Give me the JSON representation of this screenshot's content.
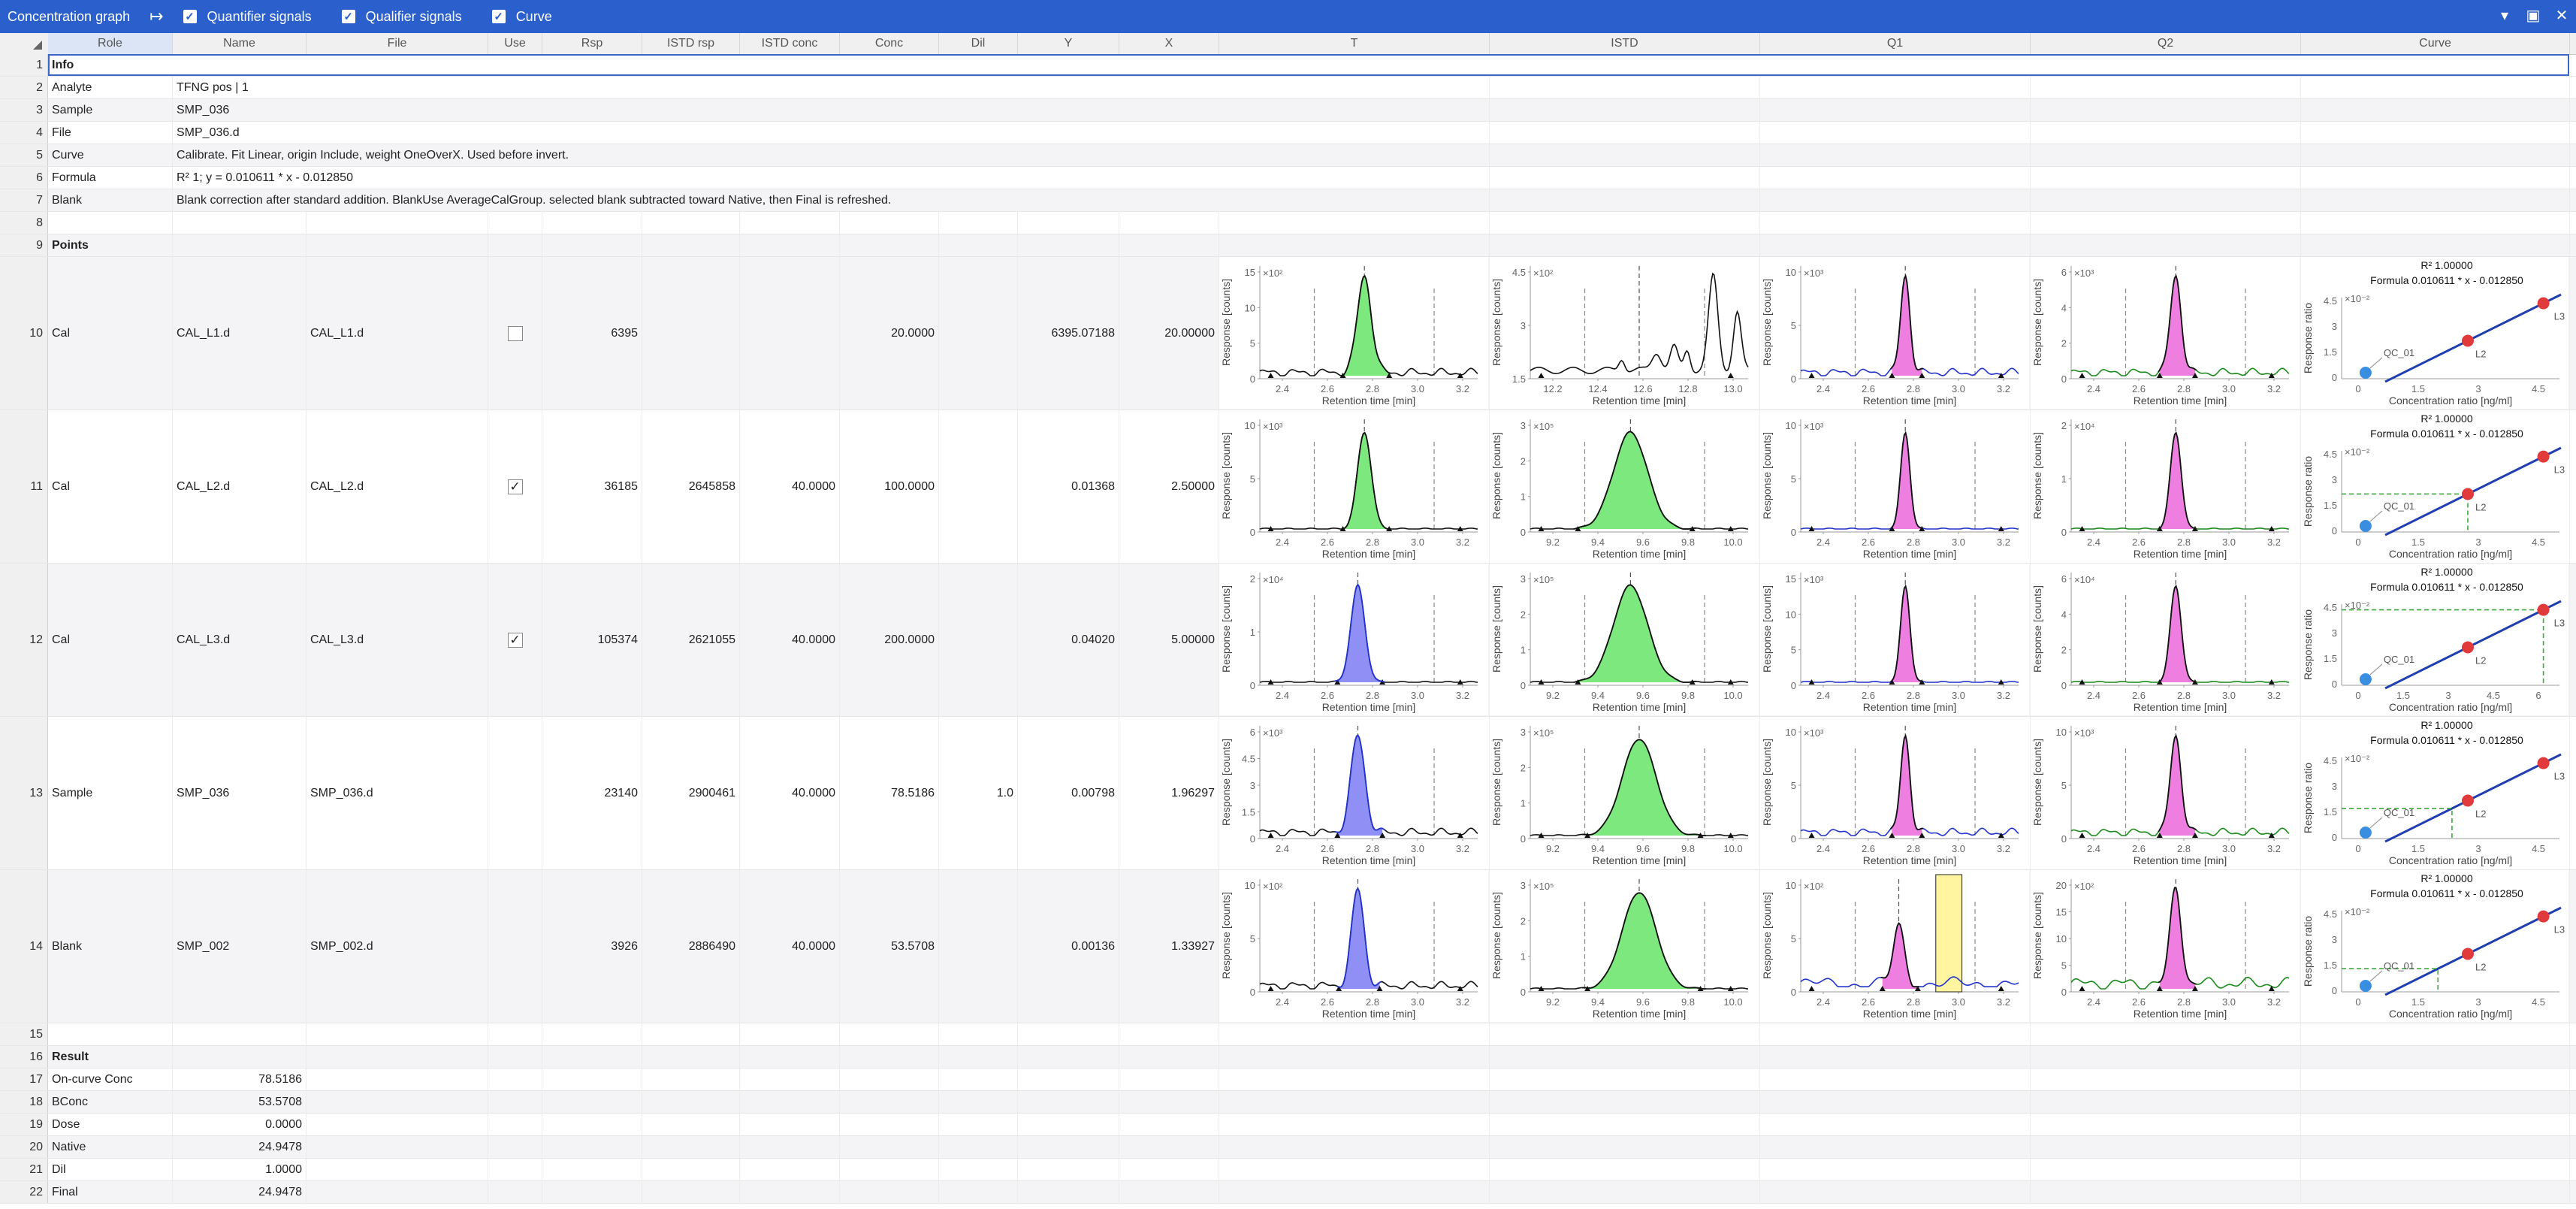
{
  "window": {
    "title": "Concentration graph",
    "expand_glyph": "↦",
    "toggles": [
      {
        "label": "Quantifier signals",
        "checked": true
      },
      {
        "label": "Qualifier signals",
        "checked": true
      },
      {
        "label": "Curve",
        "checked": true
      }
    ],
    "controls": [
      "▾",
      "▣",
      "✕"
    ]
  },
  "columns": [
    "Role",
    "Name",
    "File",
    "Use",
    "Rsp",
    "ISTD rsp",
    "ISTD conc",
    "Conc",
    "Dil",
    "Y",
    "X",
    "T",
    "ISTD",
    "Q1",
    "Q2",
    "Curve"
  ],
  "info": {
    "heading": "Info",
    "rows": [
      {
        "key": "Analyte",
        "value": "TFNG pos | 1"
      },
      {
        "key": "Sample",
        "value": "SMP_036"
      },
      {
        "key": "File",
        "value": "SMP_036.d"
      },
      {
        "key": "Curve",
        "value": "Calibrate. Fit Linear, origin Include, weight OneOverX. Used before invert."
      },
      {
        "key": "Formula",
        "value": "R² 1; y = 0.010611 * x - 0.012850"
      },
      {
        "key": "Blank",
        "value": "Blank correction after standard addition. BlankUse AverageCalGroup. selected blank subtracted toward Native, then Final is refreshed."
      }
    ]
  },
  "points_heading": "Points",
  "points": [
    {
      "n": "10",
      "role": "Cal",
      "name": "CAL_L1.d",
      "file": "CAL_L1.d",
      "use": false,
      "rsp": "6395",
      "istd_rsp": "",
      "istd_conc": "",
      "conc": "20.0000",
      "dil": "",
      "y": "6395.07188",
      "x": "20.00000"
    },
    {
      "n": "11",
      "role": "Cal",
      "name": "CAL_L2.d",
      "file": "CAL_L2.d",
      "use": true,
      "rsp": "36185",
      "istd_rsp": "2645858",
      "istd_conc": "40.0000",
      "conc": "100.0000",
      "dil": "",
      "y": "0.01368",
      "x": "2.50000"
    },
    {
      "n": "12",
      "role": "Cal",
      "name": "CAL_L3.d",
      "file": "CAL_L3.d",
      "use": true,
      "rsp": "105374",
      "istd_rsp": "2621055",
      "istd_conc": "40.0000",
      "conc": "200.0000",
      "dil": "",
      "y": "0.04020",
      "x": "5.00000"
    },
    {
      "n": "13",
      "role": "Sample",
      "name": "SMP_036",
      "file": "SMP_036.d",
      "use": null,
      "rsp": "23140",
      "istd_rsp": "2900461",
      "istd_conc": "40.0000",
      "conc": "78.5186",
      "dil": "1.0",
      "y": "0.00798",
      "x": "1.96297"
    },
    {
      "n": "14",
      "role": "Blank",
      "name": "SMP_002",
      "file": "SMP_002.d",
      "use": null,
      "rsp": "3926",
      "istd_rsp": "2886490",
      "istd_conc": "40.0000",
      "conc": "53.5708",
      "dil": "",
      "y": "0.00136",
      "x": "1.33927"
    }
  ],
  "result_heading": "Result",
  "results": [
    {
      "n": "17",
      "key": "On-curve Conc",
      "value": "78.5186"
    },
    {
      "n": "18",
      "key": "BConc",
      "value": "53.5708"
    },
    {
      "n": "19",
      "key": "Dose",
      "value": "0.0000"
    },
    {
      "n": "20",
      "key": "Native",
      "value": "24.9478"
    },
    {
      "n": "21",
      "key": "Dil",
      "value": "1.0000"
    },
    {
      "n": "22",
      "key": "Final",
      "value": "24.9478"
    }
  ],
  "plot_text": {
    "x_rt": "Retention time [min]",
    "y_rsp": "Response [counts]",
    "x_curve": "Concentration ratio [ng/ml]",
    "y_curve": "Response ratio",
    "r2": "R² 1.00000",
    "formula": "Formula 0.010611 * x - 0.012850",
    "qc_label": "QC_01",
    "l2": "L2",
    "l3": "L3",
    "curve_exp": "×10⁻²"
  },
  "colors": {
    "quant_green": "#7de87d",
    "quant_blue": "#8f8ff5",
    "qual_pink": "#ee7fe0",
    "highlight": "#fff5a0",
    "curve_line": "#1f3fb0",
    "pt_red": "#e03a3a",
    "pt_blue": "#3a8ee0"
  },
  "plots": [
    [
      {
        "kind": "chrom",
        "exp": "×10²",
        "ticks_y": [
          "15",
          "10",
          "5",
          "0"
        ],
        "ticks_x": [
          "2.4",
          "2.6",
          "2.8",
          "3.0",
          "3.2"
        ],
        "fill": "quant_green",
        "line": "#111",
        "base": "#111",
        "peak": 0.48,
        "width": 0.045,
        "noise": "low"
      },
      {
        "kind": "chrom",
        "exp": "×10²",
        "ticks_y": [
          "4.5",
          "3",
          "1.5"
        ],
        "ticks_x": [
          "12.2",
          "12.4",
          "12.6",
          "12.8",
          "13.0"
        ],
        "fill": "none",
        "line": "#111",
        "base": "#111",
        "peak": 0.5,
        "width": 0.0,
        "noise": "istd1"
      },
      {
        "kind": "chrom",
        "exp": "×10³",
        "ticks_y": [
          "10",
          "5",
          "0"
        ],
        "ticks_x": [
          "2.4",
          "2.6",
          "2.8",
          "3.0",
          "3.2"
        ],
        "fill": "qual_pink",
        "line": "#111",
        "base": "#2233cc",
        "peak": 0.48,
        "width": 0.03,
        "noise": "low"
      },
      {
        "kind": "chrom",
        "exp": "×10³",
        "ticks_y": [
          "6",
          "4",
          "2",
          "0"
        ],
        "ticks_x": [
          "2.4",
          "2.6",
          "2.8",
          "3.0",
          "3.2"
        ],
        "fill": "qual_pink",
        "line": "#111",
        "base": "#1a8a1a",
        "peak": 0.48,
        "width": 0.035,
        "noise": "low"
      },
      {
        "kind": "curve",
        "ticks_y": [
          "4.5",
          "3",
          "1.5",
          "0"
        ],
        "ticks_x": [
          "0",
          "1.5",
          "3",
          "4.5"
        ],
        "qc": [
          0.8,
          0.8
        ],
        "guide": false
      }
    ],
    [
      {
        "kind": "chrom",
        "exp": "×10³",
        "ticks_y": [
          "10",
          "5",
          "0"
        ],
        "ticks_x": [
          "2.4",
          "2.6",
          "2.8",
          "3.0",
          "3.2"
        ],
        "fill": "quant_green",
        "line": "#111",
        "base": "#111",
        "peak": 0.48,
        "width": 0.045,
        "noise": "flat"
      },
      {
        "kind": "chrom",
        "exp": "×10⁵",
        "ticks_y": [
          "3",
          "2",
          "1",
          "0"
        ],
        "ticks_x": [
          "9.2",
          "9.4",
          "9.6",
          "9.8",
          "10.0"
        ],
        "fill": "quant_green",
        "line": "#111",
        "base": "#111",
        "peak": 0.46,
        "width": 0.11,
        "noise": "flat"
      },
      {
        "kind": "chrom",
        "exp": "×10³",
        "ticks_y": [
          "10",
          "5",
          "0"
        ],
        "ticks_x": [
          "2.4",
          "2.6",
          "2.8",
          "3.0",
          "3.2"
        ],
        "fill": "qual_pink",
        "line": "#111",
        "base": "#2233cc",
        "peak": 0.48,
        "width": 0.03,
        "noise": "flat"
      },
      {
        "kind": "chrom",
        "exp": "×10⁴",
        "ticks_y": [
          "2",
          "1",
          "0"
        ],
        "ticks_x": [
          "2.4",
          "2.6",
          "2.8",
          "3.0",
          "3.2"
        ],
        "fill": "qual_pink",
        "line": "#111",
        "base": "#1a8a1a",
        "peak": 0.48,
        "width": 0.035,
        "noise": "flat"
      },
      {
        "kind": "curve",
        "ticks_y": [
          "4.5",
          "3",
          "1.5",
          "0"
        ],
        "ticks_x": [
          "0",
          "1.5",
          "3",
          "4.5"
        ],
        "qc": [
          0.8,
          0.8
        ],
        "guide": "L2"
      }
    ],
    [
      {
        "kind": "chrom",
        "exp": "×10⁴",
        "ticks_y": [
          "2",
          "1",
          "0"
        ],
        "ticks_x": [
          "2.4",
          "2.6",
          "2.8",
          "3.0",
          "3.2"
        ],
        "fill": "quant_blue",
        "line": "#2233cc",
        "base": "#111",
        "peak": 0.45,
        "width": 0.045,
        "noise": "flat"
      },
      {
        "kind": "chrom",
        "exp": "×10⁵",
        "ticks_y": [
          "3",
          "2",
          "1",
          "0"
        ],
        "ticks_x": [
          "9.2",
          "9.4",
          "9.6",
          "9.8",
          "10.0"
        ],
        "fill": "quant_green",
        "line": "#111",
        "base": "#111",
        "peak": 0.46,
        "width": 0.11,
        "noise": "flat"
      },
      {
        "kind": "chrom",
        "exp": "×10³",
        "ticks_y": [
          "15",
          "10",
          "5",
          "0"
        ],
        "ticks_x": [
          "2.4",
          "2.6",
          "2.8",
          "3.0",
          "3.2"
        ],
        "fill": "qual_pink",
        "line": "#111",
        "base": "#2233cc",
        "peak": 0.48,
        "width": 0.03,
        "noise": "flat"
      },
      {
        "kind": "chrom",
        "exp": "×10⁴",
        "ticks_y": [
          "6",
          "4",
          "2",
          "0"
        ],
        "ticks_x": [
          "2.4",
          "2.6",
          "2.8",
          "3.0",
          "3.2"
        ],
        "fill": "qual_pink",
        "line": "#111",
        "base": "#1a8a1a",
        "peak": 0.48,
        "width": 0.035,
        "noise": "flat"
      },
      {
        "kind": "curve",
        "ticks_y": [
          "4.5",
          "3",
          "1.5",
          "0"
        ],
        "ticks_x": [
          "0",
          "1.5",
          "3",
          "4.5",
          "6"
        ],
        "qc": [
          0.8,
          0.8
        ],
        "guide": "L3"
      }
    ],
    [
      {
        "kind": "chrom",
        "exp": "×10³",
        "ticks_y": [
          "6",
          "4.5",
          "3",
          "1.5",
          "0"
        ],
        "ticks_x": [
          "2.4",
          "2.6",
          "2.8",
          "3.0",
          "3.2"
        ],
        "fill": "quant_blue",
        "line": "#2233cc",
        "base": "#111",
        "peak": 0.45,
        "width": 0.045,
        "noise": "low"
      },
      {
        "kind": "chrom",
        "exp": "×10⁵",
        "ticks_y": [
          "3",
          "2",
          "1",
          "0"
        ],
        "ticks_x": [
          "9.2",
          "9.4",
          "9.6",
          "9.8",
          "10.0"
        ],
        "fill": "quant_green",
        "line": "#111",
        "base": "#111",
        "peak": 0.5,
        "width": 0.11,
        "noise": "flat"
      },
      {
        "kind": "chrom",
        "exp": "×10³",
        "ticks_y": [
          "10",
          "5",
          "0"
        ],
        "ticks_x": [
          "2.4",
          "2.6",
          "2.8",
          "3.0",
          "3.2"
        ],
        "fill": "qual_pink",
        "line": "#111",
        "base": "#2233cc",
        "peak": 0.48,
        "width": 0.03,
        "noise": "low"
      },
      {
        "kind": "chrom",
        "exp": "×10³",
        "ticks_y": [
          "10",
          "5",
          "0"
        ],
        "ticks_x": [
          "2.4",
          "2.6",
          "2.8",
          "3.0",
          "3.2"
        ],
        "fill": "qual_pink",
        "line": "#111",
        "base": "#1a8a1a",
        "peak": 0.48,
        "width": 0.035,
        "noise": "low"
      },
      {
        "kind": "curve",
        "ticks_y": [
          "4.5",
          "3",
          "1.5",
          "0"
        ],
        "ticks_x": [
          "0",
          "1.5",
          "3",
          "4.5"
        ],
        "qc": [
          0.8,
          0.8
        ],
        "guide": "sample"
      }
    ],
    [
      {
        "kind": "chrom",
        "exp": "×10²",
        "ticks_y": [
          "10",
          "5",
          "0"
        ],
        "ticks_x": [
          "2.4",
          "2.6",
          "2.8",
          "3.0",
          "3.2"
        ],
        "fill": "quant_blue",
        "line": "#2233cc",
        "base": "#111",
        "peak": 0.45,
        "width": 0.04,
        "noise": "low"
      },
      {
        "kind": "chrom",
        "exp": "×10⁵",
        "ticks_y": [
          "3",
          "2",
          "1",
          "0"
        ],
        "ticks_x": [
          "9.2",
          "9.4",
          "9.6",
          "9.8",
          "10.0"
        ],
        "fill": "quant_green",
        "line": "#111",
        "base": "#111",
        "peak": 0.5,
        "width": 0.11,
        "noise": "flat"
      },
      {
        "kind": "chrom",
        "exp": "×10²",
        "ticks_y": [
          "10",
          "5",
          "0"
        ],
        "ticks_x": [
          "2.4",
          "2.6",
          "2.8",
          "3.0",
          "3.2"
        ],
        "fill": "qual_pink",
        "line": "#111",
        "base": "#2233cc",
        "peak": 0.45,
        "width": 0.035,
        "noise": "blank",
        "highlight": true
      },
      {
        "kind": "chrom",
        "exp": "×10²",
        "ticks_y": [
          "20",
          "15",
          "10",
          "5",
          "0"
        ],
        "ticks_x": [
          "2.4",
          "2.6",
          "2.8",
          "3.0",
          "3.2"
        ],
        "fill": "qual_pink",
        "line": "#111",
        "base": "#1a8a1a",
        "peak": 0.48,
        "width": 0.035,
        "noise": "mid"
      },
      {
        "kind": "curve",
        "ticks_y": [
          "4.5",
          "3",
          "1.5",
          "0"
        ],
        "ticks_x": [
          "0",
          "1.5",
          "3",
          "4.5"
        ],
        "qc": [
          0.8,
          0.8
        ],
        "guide": "blank"
      }
    ]
  ]
}
